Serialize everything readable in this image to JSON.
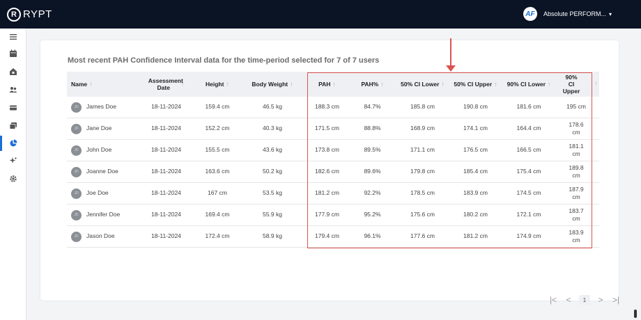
{
  "app": {
    "logo_letter": "R",
    "logo_text": "RYPT"
  },
  "org": {
    "badge": "AF",
    "name": "Absolute PERFORM...",
    "caret": "▾"
  },
  "sidebar": {
    "items": [
      {
        "icon": "menu-icon"
      },
      {
        "icon": "calendar-icon"
      },
      {
        "icon": "home-icon"
      },
      {
        "icon": "users-icon"
      },
      {
        "icon": "card-icon"
      },
      {
        "icon": "gallery-icon"
      },
      {
        "icon": "pie-chart-icon"
      },
      {
        "icon": "sparkle-icon"
      },
      {
        "icon": "gear-icon"
      }
    ],
    "active_index": 6,
    "accent": "#1b6fd6"
  },
  "card": {
    "title": "Most recent PAH Confidence Interval data for the time-period selected for 7 of 7 users"
  },
  "table": {
    "sort_glyph": "↑",
    "columns": [
      {
        "key": "name",
        "label": "Name"
      },
      {
        "key": "date",
        "label": "Assessment Date"
      },
      {
        "key": "height",
        "label": "Height"
      },
      {
        "key": "weight",
        "label": "Body Weight"
      },
      {
        "key": "pah",
        "label": "PAH"
      },
      {
        "key": "pahp",
        "label": "PAH%"
      },
      {
        "key": "l50",
        "label": "50% CI Lower"
      },
      {
        "key": "u50",
        "label": "50% CI Upper"
      },
      {
        "key": "l90",
        "label": "90% CI Lower"
      },
      {
        "key": "u90",
        "label": "90% CI Upper"
      }
    ],
    "rows": [
      {
        "initials": "JD",
        "name": "James Doe",
        "date": "18-11-2024",
        "height": "159.4 cm",
        "weight": "46.5 kg",
        "pah": "188.3 cm",
        "pahp": "84.7%",
        "l50": "185.8 cm",
        "u50": "190.8 cm",
        "l90": "181.6 cm",
        "u90": "195 cm"
      },
      {
        "initials": "JD",
        "name": "Jane Doe",
        "date": "18-11-2024",
        "height": "152.2 cm",
        "weight": "40.3 kg",
        "pah": "171.5 cm",
        "pahp": "88.8%",
        "l50": "168.9 cm",
        "u50": "174.1 cm",
        "l90": "164.4 cm",
        "u90": "178.6 cm"
      },
      {
        "initials": "JD",
        "name": "John Doe",
        "date": "18-11-2024",
        "height": "155.5 cm",
        "weight": "43.6 kg",
        "pah": "173.8 cm",
        "pahp": "89.5%",
        "l50": "171.1 cm",
        "u50": "176.5 cm",
        "l90": "166.5 cm",
        "u90": "181.1 cm"
      },
      {
        "initials": "JD",
        "name": "Joanne Doe",
        "date": "18-11-2024",
        "height": "163.6 cm",
        "weight": "50.2 kg",
        "pah": "182.6 cm",
        "pahp": "89.6%",
        "l50": "179.8 cm",
        "u50": "185.4 cm",
        "l90": "175.4 cm",
        "u90": "189.8 cm"
      },
      {
        "initials": "JD",
        "name": "Joe Doe",
        "date": "18-11-2024",
        "height": "167 cm",
        "weight": "53.5 kg",
        "pah": "181.2 cm",
        "pahp": "92.2%",
        "l50": "178.5 cm",
        "u50": "183.9 cm",
        "l90": "174.5 cm",
        "u90": "187.9 cm"
      },
      {
        "initials": "JD",
        "name": "Jennifer Doe",
        "date": "18-11-2024",
        "height": "169.4 cm",
        "weight": "55.9 kg",
        "pah": "177.9 cm",
        "pahp": "95.2%",
        "l50": "175.6 cm",
        "u50": "180.2 cm",
        "l90": "172.1 cm",
        "u90": "183.7 cm"
      },
      {
        "initials": "JD",
        "name": "Jason Doe",
        "date": "18-11-2024",
        "height": "172.4 cm",
        "weight": "58.9 kg",
        "pah": "179.4 cm",
        "pahp": "96.1%",
        "l50": "177.6 cm",
        "u50": "181.2 cm",
        "l90": "174.9 cm",
        "u90": "183.9 cm"
      }
    ]
  },
  "pagination": {
    "first": "|<",
    "prev": "<",
    "page": "1",
    "next": ">",
    "last": ">|"
  },
  "annotation_color": "#d9534f"
}
